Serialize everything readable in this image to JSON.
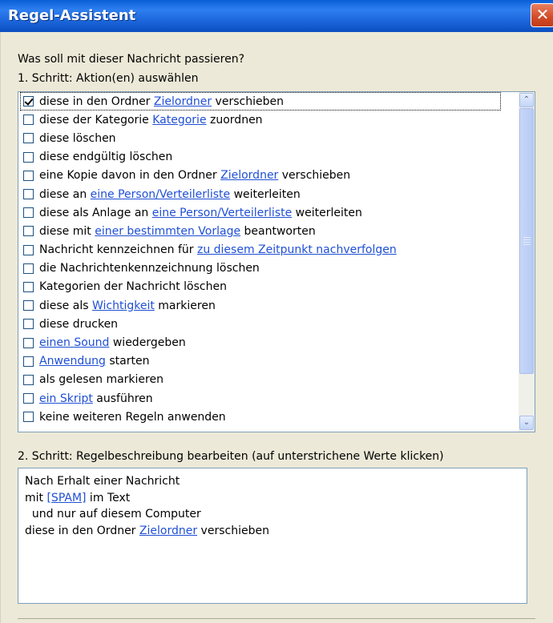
{
  "window": {
    "title": "Regel-Assistent",
    "close_glyph": "✕"
  },
  "prompt": "Was soll mit dieser Nachricht passieren?",
  "step1": "1. Schritt: Aktion(en) auswählen",
  "actions": [
    {
      "checked": true,
      "parts": [
        {
          "t": "diese in den Ordner "
        },
        {
          "t": "Zielordner",
          "link": true
        },
        {
          "t": " verschieben"
        }
      ]
    },
    {
      "checked": false,
      "parts": [
        {
          "t": "diese der Kategorie "
        },
        {
          "t": "Kategorie",
          "link": true
        },
        {
          "t": " zuordnen"
        }
      ]
    },
    {
      "checked": false,
      "parts": [
        {
          "t": "diese löschen"
        }
      ]
    },
    {
      "checked": false,
      "parts": [
        {
          "t": "diese endgültig löschen"
        }
      ]
    },
    {
      "checked": false,
      "parts": [
        {
          "t": "eine Kopie davon in den Ordner "
        },
        {
          "t": "Zielordner",
          "link": true
        },
        {
          "t": " verschieben"
        }
      ]
    },
    {
      "checked": false,
      "parts": [
        {
          "t": "diese an "
        },
        {
          "t": "eine Person/Verteilerliste",
          "link": true
        },
        {
          "t": " weiterleiten"
        }
      ]
    },
    {
      "checked": false,
      "parts": [
        {
          "t": "diese als Anlage an "
        },
        {
          "t": "eine Person/Verteilerliste",
          "link": true
        },
        {
          "t": " weiterleiten"
        }
      ]
    },
    {
      "checked": false,
      "parts": [
        {
          "t": "diese mit "
        },
        {
          "t": "einer bestimmten Vorlage",
          "link": true
        },
        {
          "t": " beantworten"
        }
      ]
    },
    {
      "checked": false,
      "parts": [
        {
          "t": "Nachricht kennzeichnen für "
        },
        {
          "t": "zu diesem Zeitpunkt nachverfolgen",
          "link": true
        }
      ]
    },
    {
      "checked": false,
      "parts": [
        {
          "t": "die Nachrichtenkennzeichnung löschen"
        }
      ]
    },
    {
      "checked": false,
      "parts": [
        {
          "t": "Kategorien der Nachricht löschen"
        }
      ]
    },
    {
      "checked": false,
      "parts": [
        {
          "t": "diese als "
        },
        {
          "t": "Wichtigkeit",
          "link": true
        },
        {
          "t": " markieren"
        }
      ]
    },
    {
      "checked": false,
      "parts": [
        {
          "t": "diese drucken"
        }
      ]
    },
    {
      "checked": false,
      "parts": [
        {
          "t": "einen Sound",
          "link": true
        },
        {
          "t": " wiedergeben"
        }
      ]
    },
    {
      "checked": false,
      "parts": [
        {
          "t": "Anwendung",
          "link": true
        },
        {
          "t": " starten"
        }
      ]
    },
    {
      "checked": false,
      "parts": [
        {
          "t": "als gelesen markieren"
        }
      ]
    },
    {
      "checked": false,
      "parts": [
        {
          "t": "ein Skript",
          "link": true
        },
        {
          "t": " ausführen"
        }
      ]
    },
    {
      "checked": false,
      "parts": [
        {
          "t": "keine weiteren Regeln anwenden"
        }
      ]
    }
  ],
  "step2": "2. Schritt: Regelbeschreibung bearbeiten (auf unterstrichene Werte klicken)",
  "description": [
    [
      {
        "t": "Nach Erhalt einer Nachricht"
      }
    ],
    [
      {
        "t": "mit "
      },
      {
        "t": "[SPAM]",
        "link": true
      },
      {
        "t": " im Text"
      }
    ],
    [
      {
        "t": "  und nur auf diesem Computer"
      }
    ],
    [
      {
        "t": "diese in den Ordner "
      },
      {
        "t": "Zielordner",
        "link": true
      },
      {
        "t": " verschieben"
      }
    ]
  ],
  "scrollbar": {
    "up_glyph": "⌃",
    "down_glyph": "⌄"
  },
  "colors": {
    "link": "#1f4fd4",
    "titlebar": "#0a5fd6",
    "close": "#d24a28",
    "dialog_bg": "#ece9d8"
  }
}
